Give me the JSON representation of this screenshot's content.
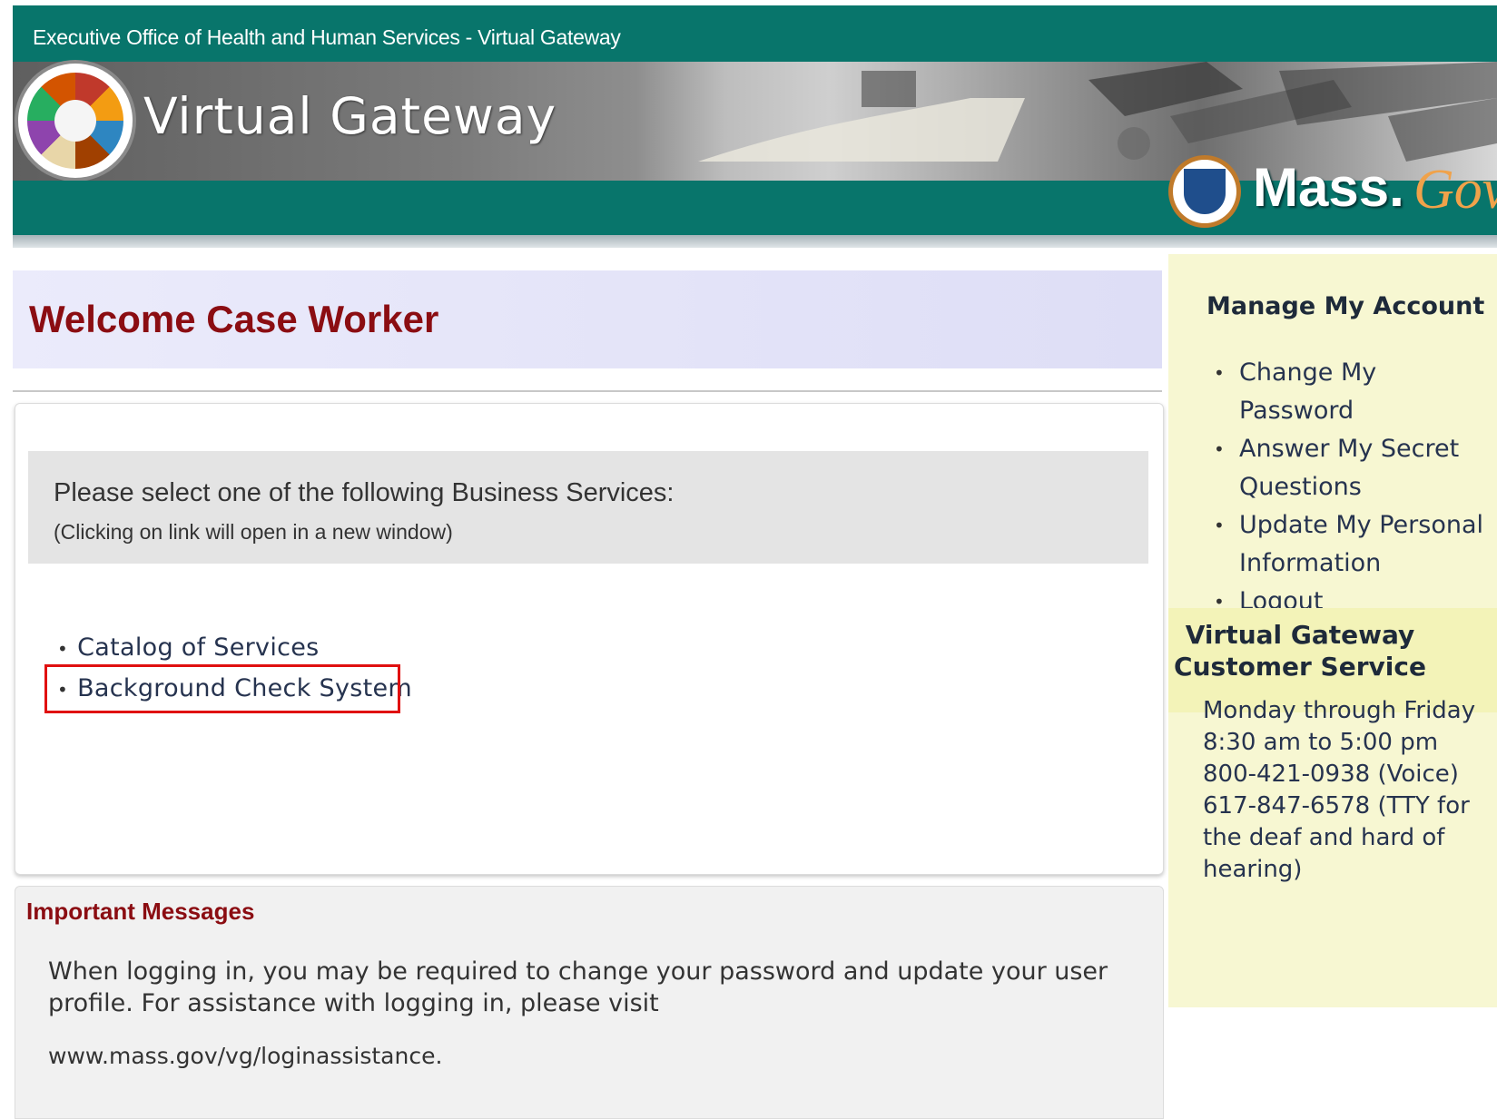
{
  "header": {
    "agency": "Executive Office of Health and Human Services - Virtual Gateway",
    "site_title": "Virtual Gateway",
    "brand": "Mass.",
    "brand_script": "Gov"
  },
  "welcome": {
    "title": "Welcome Case Worker"
  },
  "services": {
    "prompt": "Please select one of the following Business Services:",
    "note": "(Clicking on link will open in a new window)",
    "items": [
      {
        "label": "Catalog of Services"
      },
      {
        "label": "Background Check System"
      }
    ]
  },
  "messages": {
    "title": "Important Messages",
    "body": "When logging in, you may be required to change your password and update your user profile. For assistance with logging in, please visit",
    "link": "www.mass.gov/vg/loginassistance."
  },
  "account": {
    "title": "Manage My Account",
    "items": [
      {
        "label": "Change My Password"
      },
      {
        "label": "Answer My Secret Questions"
      },
      {
        "label": "Update My Personal Information"
      },
      {
        "label": "Logout"
      }
    ]
  },
  "customer_service": {
    "title_line1": "Virtual Gateway",
    "title_line2": "Customer Service",
    "days": "Monday through Friday",
    "hours": "8:30 am to 5:00 pm",
    "voice": "800-421-0938 (Voice)",
    "tty": "617-847-6578 (TTY for the deaf and hard of hearing)"
  },
  "colors": {
    "header_green": "#08756b",
    "title_maroon": "#8b0d12",
    "sidebar_yellow": "#f7f7d2",
    "highlight_red": "#e01010"
  }
}
